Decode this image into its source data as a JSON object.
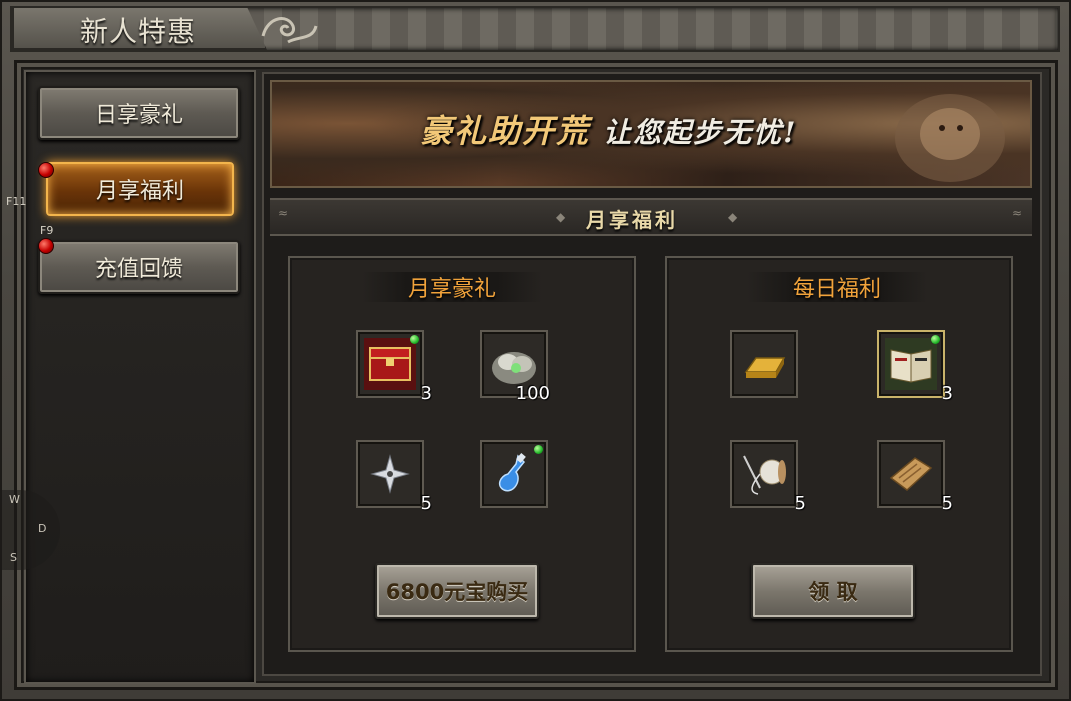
{
  "window": {
    "title": "新人特惠"
  },
  "sidebar": {
    "tabs": [
      {
        "label": "日享豪礼",
        "active": false,
        "badge": false
      },
      {
        "label": "月享福利",
        "active": true,
        "badge": true
      },
      {
        "label": "充值回馈",
        "active": false,
        "badge": true
      }
    ],
    "hotkeys": [
      "F11",
      "F9"
    ],
    "edge_letters": [
      "W",
      "D",
      "S"
    ]
  },
  "banner": {
    "text_part1": "豪礼助开荒",
    "text_part2": "让您起步无忧!"
  },
  "section": {
    "title": "月享福利"
  },
  "monthly": {
    "title": "月享豪礼",
    "items": [
      {
        "icon": "red-treasure-chest-icon",
        "qty": "3",
        "new": true
      },
      {
        "icon": "silver-ingot-pile-icon",
        "qty": "100",
        "new": false
      },
      {
        "icon": "shuriken-icon",
        "qty": "5",
        "new": false
      },
      {
        "icon": "blue-potion-icon",
        "qty": "",
        "new": true
      }
    ],
    "button_label": "6800元宝购买"
  },
  "daily": {
    "title": "每日福利",
    "items": [
      {
        "icon": "gold-bar-icon",
        "qty": "",
        "new": false
      },
      {
        "icon": "skill-book-icon",
        "qty": "3",
        "new": true
      },
      {
        "icon": "thread-spool-icon",
        "qty": "5",
        "new": false
      },
      {
        "icon": "scroll-icon",
        "qty": "5",
        "new": false
      }
    ],
    "button_label": "领 取"
  },
  "colors": {
    "panel_title": "#f1a33b",
    "active_tab": "#a5601a",
    "badge_red": "#c40000"
  }
}
